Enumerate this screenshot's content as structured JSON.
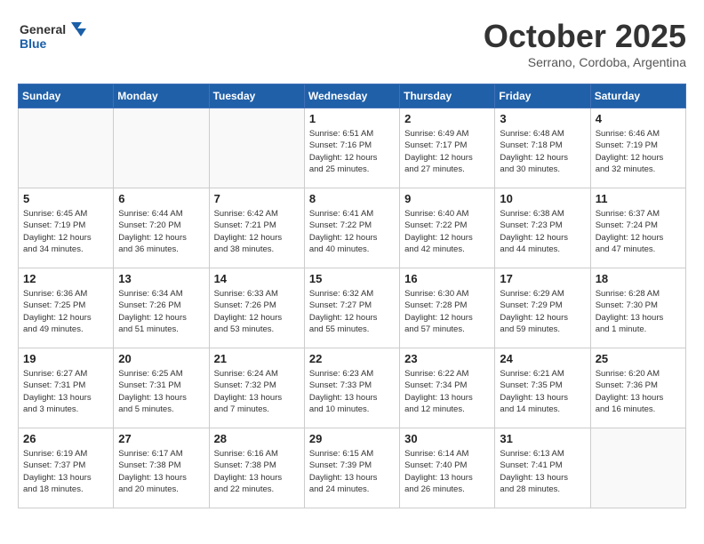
{
  "header": {
    "logo_line1": "General",
    "logo_line2": "Blue",
    "month": "October 2025",
    "location": "Serrano, Cordoba, Argentina"
  },
  "weekdays": [
    "Sunday",
    "Monday",
    "Tuesday",
    "Wednesday",
    "Thursday",
    "Friday",
    "Saturday"
  ],
  "weeks": [
    [
      {
        "day": "",
        "info": ""
      },
      {
        "day": "",
        "info": ""
      },
      {
        "day": "",
        "info": ""
      },
      {
        "day": "1",
        "info": "Sunrise: 6:51 AM\nSunset: 7:16 PM\nDaylight: 12 hours\nand 25 minutes."
      },
      {
        "day": "2",
        "info": "Sunrise: 6:49 AM\nSunset: 7:17 PM\nDaylight: 12 hours\nand 27 minutes."
      },
      {
        "day": "3",
        "info": "Sunrise: 6:48 AM\nSunset: 7:18 PM\nDaylight: 12 hours\nand 30 minutes."
      },
      {
        "day": "4",
        "info": "Sunrise: 6:46 AM\nSunset: 7:19 PM\nDaylight: 12 hours\nand 32 minutes."
      }
    ],
    [
      {
        "day": "5",
        "info": "Sunrise: 6:45 AM\nSunset: 7:19 PM\nDaylight: 12 hours\nand 34 minutes."
      },
      {
        "day": "6",
        "info": "Sunrise: 6:44 AM\nSunset: 7:20 PM\nDaylight: 12 hours\nand 36 minutes."
      },
      {
        "day": "7",
        "info": "Sunrise: 6:42 AM\nSunset: 7:21 PM\nDaylight: 12 hours\nand 38 minutes."
      },
      {
        "day": "8",
        "info": "Sunrise: 6:41 AM\nSunset: 7:22 PM\nDaylight: 12 hours\nand 40 minutes."
      },
      {
        "day": "9",
        "info": "Sunrise: 6:40 AM\nSunset: 7:22 PM\nDaylight: 12 hours\nand 42 minutes."
      },
      {
        "day": "10",
        "info": "Sunrise: 6:38 AM\nSunset: 7:23 PM\nDaylight: 12 hours\nand 44 minutes."
      },
      {
        "day": "11",
        "info": "Sunrise: 6:37 AM\nSunset: 7:24 PM\nDaylight: 12 hours\nand 47 minutes."
      }
    ],
    [
      {
        "day": "12",
        "info": "Sunrise: 6:36 AM\nSunset: 7:25 PM\nDaylight: 12 hours\nand 49 minutes."
      },
      {
        "day": "13",
        "info": "Sunrise: 6:34 AM\nSunset: 7:26 PM\nDaylight: 12 hours\nand 51 minutes."
      },
      {
        "day": "14",
        "info": "Sunrise: 6:33 AM\nSunset: 7:26 PM\nDaylight: 12 hours\nand 53 minutes."
      },
      {
        "day": "15",
        "info": "Sunrise: 6:32 AM\nSunset: 7:27 PM\nDaylight: 12 hours\nand 55 minutes."
      },
      {
        "day": "16",
        "info": "Sunrise: 6:30 AM\nSunset: 7:28 PM\nDaylight: 12 hours\nand 57 minutes."
      },
      {
        "day": "17",
        "info": "Sunrise: 6:29 AM\nSunset: 7:29 PM\nDaylight: 12 hours\nand 59 minutes."
      },
      {
        "day": "18",
        "info": "Sunrise: 6:28 AM\nSunset: 7:30 PM\nDaylight: 13 hours\nand 1 minute."
      }
    ],
    [
      {
        "day": "19",
        "info": "Sunrise: 6:27 AM\nSunset: 7:31 PM\nDaylight: 13 hours\nand 3 minutes."
      },
      {
        "day": "20",
        "info": "Sunrise: 6:25 AM\nSunset: 7:31 PM\nDaylight: 13 hours\nand 5 minutes."
      },
      {
        "day": "21",
        "info": "Sunrise: 6:24 AM\nSunset: 7:32 PM\nDaylight: 13 hours\nand 7 minutes."
      },
      {
        "day": "22",
        "info": "Sunrise: 6:23 AM\nSunset: 7:33 PM\nDaylight: 13 hours\nand 10 minutes."
      },
      {
        "day": "23",
        "info": "Sunrise: 6:22 AM\nSunset: 7:34 PM\nDaylight: 13 hours\nand 12 minutes."
      },
      {
        "day": "24",
        "info": "Sunrise: 6:21 AM\nSunset: 7:35 PM\nDaylight: 13 hours\nand 14 minutes."
      },
      {
        "day": "25",
        "info": "Sunrise: 6:20 AM\nSunset: 7:36 PM\nDaylight: 13 hours\nand 16 minutes."
      }
    ],
    [
      {
        "day": "26",
        "info": "Sunrise: 6:19 AM\nSunset: 7:37 PM\nDaylight: 13 hours\nand 18 minutes."
      },
      {
        "day": "27",
        "info": "Sunrise: 6:17 AM\nSunset: 7:38 PM\nDaylight: 13 hours\nand 20 minutes."
      },
      {
        "day": "28",
        "info": "Sunrise: 6:16 AM\nSunset: 7:38 PM\nDaylight: 13 hours\nand 22 minutes."
      },
      {
        "day": "29",
        "info": "Sunrise: 6:15 AM\nSunset: 7:39 PM\nDaylight: 13 hours\nand 24 minutes."
      },
      {
        "day": "30",
        "info": "Sunrise: 6:14 AM\nSunset: 7:40 PM\nDaylight: 13 hours\nand 26 minutes."
      },
      {
        "day": "31",
        "info": "Sunrise: 6:13 AM\nSunset: 7:41 PM\nDaylight: 13 hours\nand 28 minutes."
      },
      {
        "day": "",
        "info": ""
      }
    ]
  ]
}
